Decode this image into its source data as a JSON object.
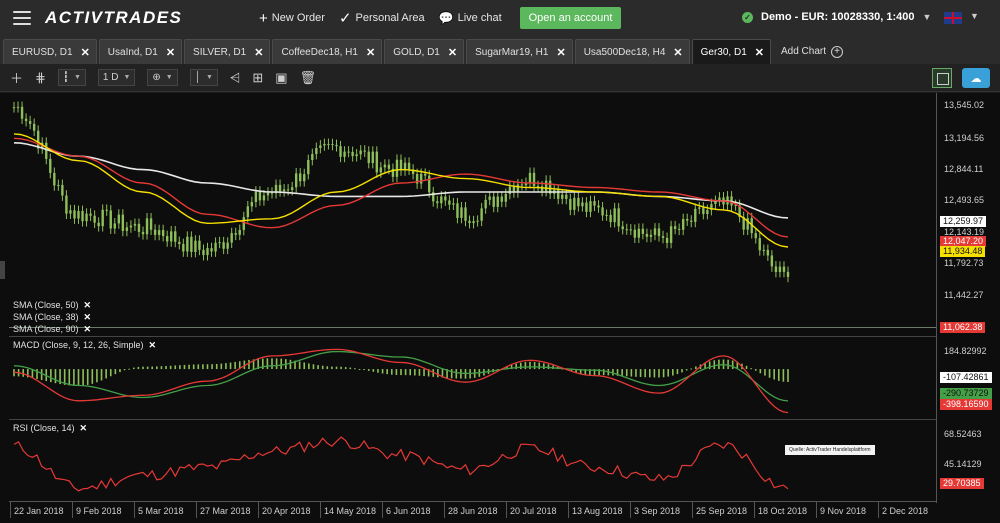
{
  "header": {
    "logo": "ACTIVTRADES",
    "nav": [
      {
        "icon": "plus-icon",
        "glyph": "+",
        "label": "New Order"
      },
      {
        "icon": "check-icon",
        "glyph": "✓",
        "label": "Personal Area"
      },
      {
        "icon": "chat-icon",
        "glyph": "💬",
        "label": "Live chat"
      }
    ],
    "open_account": "Open an account",
    "account": "Demo - EUR: 10028330, 1:400",
    "language_icon": "uk-flag-icon"
  },
  "tabs": [
    {
      "label": "EURUSD, D1",
      "active": false
    },
    {
      "label": "UsaInd, D1",
      "active": false
    },
    {
      "label": "SILVER, D1",
      "active": false
    },
    {
      "label": "CoffeeDec18, H1",
      "active": false
    },
    {
      "label": "GOLD, D1",
      "active": false
    },
    {
      "label": "SugarMar19, H1",
      "active": false
    },
    {
      "label": "Usa500Dec18, H4",
      "active": false
    },
    {
      "label": "Ger30, D1",
      "active": true
    }
  ],
  "add_chart": "Add Chart",
  "toolbar": {
    "timeframe": "1 D"
  },
  "price_axis": {
    "main_ticks": [
      "13,545.02",
      "13,194.56",
      "12,844.11",
      "12,493.65",
      "12,143.19",
      "11,792.73",
      "11,442.27"
    ],
    "main_tags": [
      {
        "value": "12,259.97",
        "bg": "#ffffff",
        "fg": "#111111"
      },
      {
        "value": "12,047.20",
        "bg": "#e53935",
        "fg": "#ffffff"
      },
      {
        "value": "11,934.48",
        "bg": "#f5e000",
        "fg": "#111111"
      },
      {
        "value": "11,062.38",
        "bg": "#e53935",
        "fg": "#ffffff"
      }
    ],
    "macd_ticks": [
      "184.82992"
    ],
    "macd_tags": [
      {
        "value": "-107.42861",
        "bg": "#ffffff",
        "fg": "#111111"
      },
      {
        "value": "-290.73729",
        "bg": "#43a047",
        "fg": "#111111"
      },
      {
        "value": "-398.16590",
        "bg": "#e53935",
        "fg": "#ffffff"
      }
    ],
    "rsi_ticks": [
      "68.52463",
      "45.14129"
    ],
    "rsi_tags": [
      {
        "value": "29.70385",
        "bg": "#e53935",
        "fg": "#ffffff"
      }
    ]
  },
  "legends": {
    "sma": [
      "SMA (Close, 50)",
      "SMA (Close, 38)",
      "SMA (Close, 90)"
    ],
    "macd": "MACD (Close, 9, 12, 26, Simple)",
    "rsi": "RSI (Close, 14)"
  },
  "watermark": "Quelle: ActivTrader Handelsplattform",
  "x_axis_labels": [
    "22 Jan 2018",
    "9 Feb 2018",
    "5 Mar 2018",
    "27 Mar 2018",
    "20 Apr 2018",
    "14 May 2018",
    "6 Jun 2018",
    "28 Jun 2018",
    "20 Jul 2018",
    "13 Aug 2018",
    "3 Sep 2018",
    "25 Sep 2018",
    "18 Oct 2018",
    "9 Nov 2018",
    "2 Dec 2018"
  ],
  "colors": {
    "bull": "#8fbf5a",
    "sma50": "#e53935",
    "sma38": "#f5e000",
    "sma90": "#e8e8e8",
    "macd": "#e53935",
    "signal": "#43a047",
    "rsi": "#e53935"
  },
  "chart_data": {
    "type": "line",
    "symbol": "Ger30",
    "timeframe": "D1",
    "x": [
      "22 Jan 2018",
      "9 Feb 2018",
      "5 Mar 2018",
      "27 Mar 2018",
      "20 Apr 2018",
      "14 May 2018",
      "6 Jun 2018",
      "28 Jun 2018",
      "20 Jul 2018",
      "13 Aug 2018",
      "3 Sep 2018",
      "25 Sep 2018",
      "18 Oct 2018"
    ],
    "series": [
      {
        "name": "Close",
        "values": [
          13500,
          12300,
          12150,
          11900,
          12550,
          13050,
          12800,
          12300,
          12700,
          12350,
          12050,
          12400,
          11600
        ]
      },
      {
        "name": "SMA (Close, 50)",
        "values": [
          13150,
          12950,
          12650,
          12300,
          12150,
          12400,
          12650,
          12750,
          12650,
          12600,
          12550,
          12450,
          12047.2
        ]
      },
      {
        "name": "SMA (Close, 38)",
        "values": [
          13200,
          12900,
          12550,
          12200,
          12250,
          12550,
          12800,
          12700,
          12600,
          12550,
          12500,
          12350,
          11934.48
        ]
      },
      {
        "name": "SMA (Close, 90)",
        "values": [
          13100,
          12950,
          12800,
          12650,
          12550,
          12500,
          12500,
          12550,
          12550,
          12550,
          12500,
          12450,
          12259.97
        ]
      }
    ],
    "ylim": [
      11062.38,
      13545.02
    ],
    "macd": {
      "macd": [
        -30,
        -290,
        -240,
        -110,
        120,
        180,
        60,
        -120,
        80,
        -60,
        -220,
        120,
        -398.1659
      ],
      "signal": [
        30,
        -150,
        -260,
        -150,
        30,
        160,
        110,
        -40,
        20,
        -10,
        -150,
        40,
        -290.73729
      ]
    },
    "rsi": [
      62,
      30,
      40,
      46,
      58,
      66,
      55,
      44,
      60,
      46,
      37,
      63,
      29.70385
    ]
  }
}
